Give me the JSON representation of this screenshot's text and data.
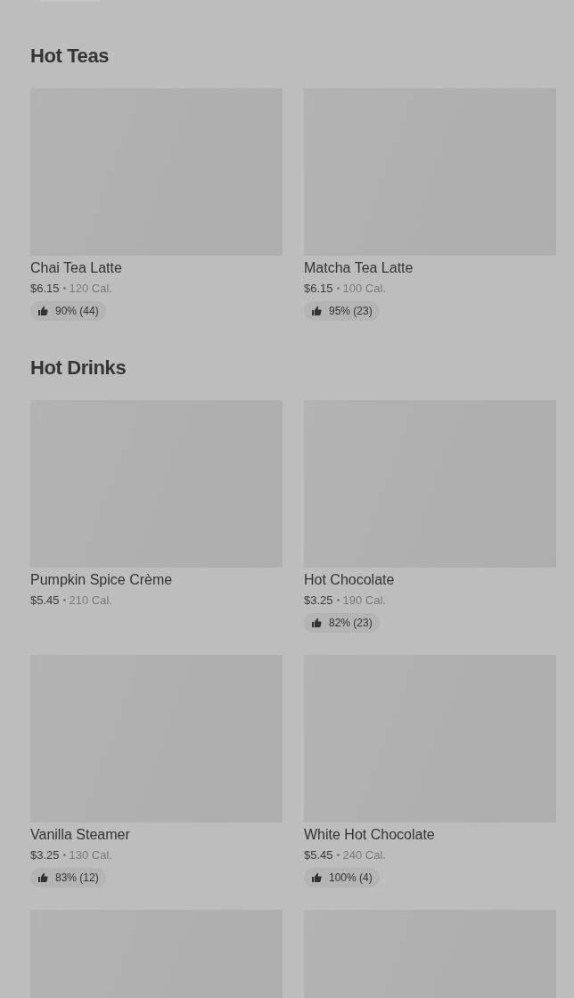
{
  "sections": [
    {
      "title": "Hot Teas",
      "items": [
        {
          "kind": "product",
          "name": "Chai Tea Latte",
          "price": "$6.15",
          "calories": "120 Cal.",
          "rating": "90% (44)"
        },
        {
          "kind": "product",
          "name": "Matcha Tea Latte",
          "price": "$6.15",
          "calories": "100 Cal.",
          "rating": "95% (23)"
        }
      ]
    },
    {
      "title": "Hot Drinks",
      "items": [
        {
          "kind": "product",
          "name": "Pumpkin Spice Crème",
          "price": "$5.45",
          "calories": "210 Cal."
        },
        {
          "kind": "product",
          "name": "Hot Chocolate",
          "price": "$3.25",
          "calories": "190 Cal.",
          "rating": "82% (23)"
        },
        {
          "kind": "product",
          "name": "Vanilla Steamer",
          "price": "$3.25",
          "calories": "130 Cal.",
          "rating": "83% (12)"
        },
        {
          "kind": "product",
          "name": "White Hot Chocolate",
          "price": "$5.45",
          "calories": "240 Cal.",
          "rating": "100% (4)"
        },
        {
          "kind": "image-only"
        },
        {
          "kind": "image-only"
        }
      ]
    }
  ]
}
